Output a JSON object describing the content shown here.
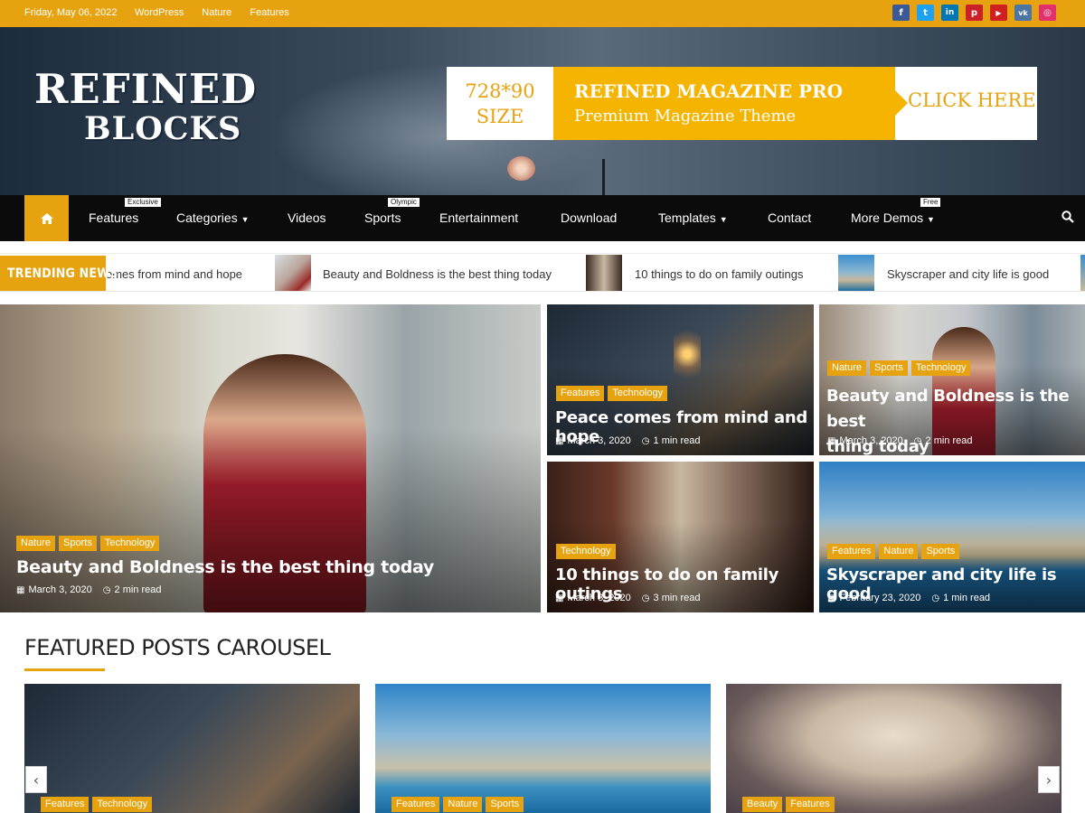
{
  "topbar": {
    "date": "Friday, May 06, 2022",
    "links": [
      "WordPress",
      "Nature",
      "Features"
    ],
    "social": [
      {
        "icon": "facebook-icon",
        "glyph": "f",
        "color": "#3b5998"
      },
      {
        "icon": "twitter-icon",
        "glyph": "t",
        "color": "#1da1f2"
      },
      {
        "icon": "linkedin-icon",
        "glyph": "in",
        "color": "#0077b5"
      },
      {
        "icon": "pinterest-icon",
        "glyph": "p",
        "color": "#cb2027"
      },
      {
        "icon": "youtube-icon",
        "glyph": "▶",
        "color": "#cd201f"
      },
      {
        "icon": "vk-icon",
        "glyph": "vk",
        "color": "#4c75a3"
      },
      {
        "icon": "instagram-icon",
        "glyph": "◎",
        "color": "#e1306c"
      }
    ]
  },
  "header": {
    "logo_line1": "REFINED",
    "logo_line2": "BLOCKS",
    "ad": {
      "size_line1": "728*90",
      "size_line2": "SIZE",
      "title": "REFINED MAGAZINE PRO",
      "subtitle": "Premium Magazine Theme",
      "cta": "CLICK HERE"
    }
  },
  "nav": {
    "items": [
      "Features",
      "Categories",
      "Videos",
      "Sports",
      "Entertainment",
      "Download",
      "Templates",
      "Contact",
      "More Demos"
    ],
    "badges": {
      "features": "Exclusive",
      "sports": "Olympic",
      "more_demos": "Free"
    }
  },
  "trending": {
    "label": "TRENDING NEWS",
    "items": [
      "omes from mind and hope",
      "Beauty and Boldness is the best thing today",
      "10 things to do on family outings",
      "Skyscraper and city life is good"
    ]
  },
  "hero": {
    "main": {
      "cats": [
        "Nature",
        "Sports",
        "Technology"
      ],
      "title": "Beauty and Boldness is the best thing today",
      "date": "March 3, 2020",
      "read": "2 min read"
    },
    "top_mid": {
      "cats": [
        "Features",
        "Technology"
      ],
      "title": "Peace comes from mind and hope",
      "date": "March 3, 2020",
      "read": "1 min read"
    },
    "top_right": {
      "cats": [
        "Nature",
        "Sports",
        "Technology"
      ],
      "title_line1": "Beauty and Boldness is the best",
      "title_line2": "thing today",
      "date": "March 3, 2020",
      "read": "2 min read"
    },
    "bottom_mid": {
      "cats": [
        "Technology"
      ],
      "title": "10 things to do on family outings",
      "date": "March 3, 2020",
      "read": "3 min read"
    },
    "bottom_right": {
      "cats": [
        "Features",
        "Nature",
        "Sports"
      ],
      "title": "Skyscraper and city life is good",
      "date": "February 23, 2020",
      "read": "1 min read"
    }
  },
  "featured": {
    "title": "FEATURED POSTS CAROUSEL",
    "cards": [
      {
        "cats": [
          "Features",
          "Technology"
        ]
      },
      {
        "cats": [
          "Features",
          "Nature",
          "Sports"
        ]
      },
      {
        "cats": [
          "Beauty",
          "Features"
        ]
      }
    ],
    "prev": "‹",
    "next": "›"
  },
  "colors": {
    "accent": "#e6a30f",
    "nav_bg": "#0b0b0b"
  }
}
